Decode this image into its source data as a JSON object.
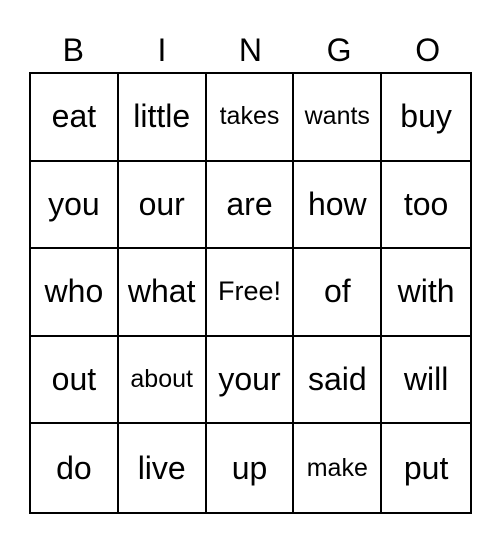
{
  "header": [
    "B",
    "I",
    "N",
    "G",
    "O"
  ],
  "cells": [
    "eat",
    "little",
    "takes",
    "wants",
    "buy",
    "you",
    "our",
    "are",
    "how",
    "too",
    "who",
    "what",
    "Free!",
    "of",
    "with",
    "out",
    "about",
    "your",
    "said",
    "will",
    "do",
    "live",
    "up",
    "make",
    "put"
  ]
}
